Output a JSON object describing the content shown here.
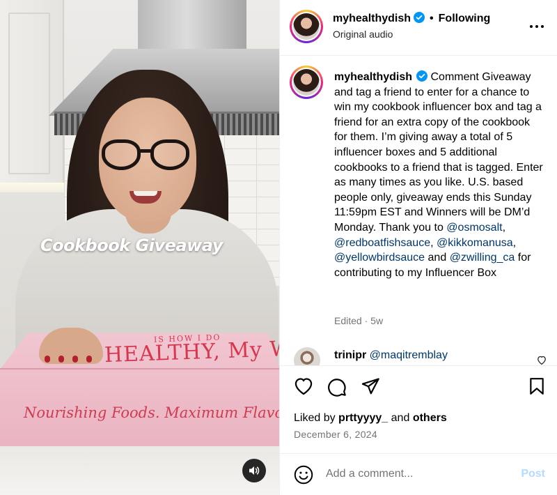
{
  "media": {
    "overlay_text": "Cookbook Giveaway",
    "box_title_small": "IS HOW I DO",
    "box_title": "HEALTHY, My WAY",
    "box_tagline": "Nourishing Foods. Maximum Flavor.",
    "audio_icon": "speaker-icon"
  },
  "header": {
    "username": "myhealthydish",
    "separator": "•",
    "follow_label": "Following",
    "subtitle": "Original audio",
    "more_icon": "more-horizontal-icon"
  },
  "caption": {
    "username": "myhealthydish",
    "label": "Comment",
    "text_1": "Giveaway and tag a friend to enter for a chance to win my cookbook influencer box and tag a friend for an extra copy of the cookbook for them. I’m giving away a total of 5 influencer boxes and 5 additional cookbooks to a friend that is tagged. Enter as many times as you like. U.S. based people only, giveaway ends this Sunday 11:59pm EST and Winners will be DM’d Monday. Thank you to",
    "mention_1": "@osmosalt",
    "sep_1": ",",
    "mention_2": "@redboatfishsauce",
    "sep_2": ",",
    "mention_3": "@kikkomanusa",
    "sep_3": ",",
    "mention_4": "@yellowbirdsauce",
    "and": "and",
    "mention_5": "@zwilling_ca",
    "text_2": "for contributing to my Influencer Box",
    "edited": "Edited",
    "meta_sep": "·",
    "age": "5w"
  },
  "reply": {
    "username": "trinipr",
    "mention": "@maqitremblay"
  },
  "actions": {
    "liked_by_prefix": "Liked by",
    "liked_by_user": "prttyyyy_",
    "liked_by_and": "and",
    "liked_by_others": "others",
    "date": "December 6, 2024"
  },
  "add_comment": {
    "placeholder": "Add a comment...",
    "post_label": "Post"
  },
  "colors": {
    "link": "#00376b",
    "secondary_text": "#737373",
    "verified_blue": "#0095f6",
    "post_disabled": "#b3dbff",
    "box_pink": "#eab4c2",
    "box_red": "#d6364e"
  }
}
